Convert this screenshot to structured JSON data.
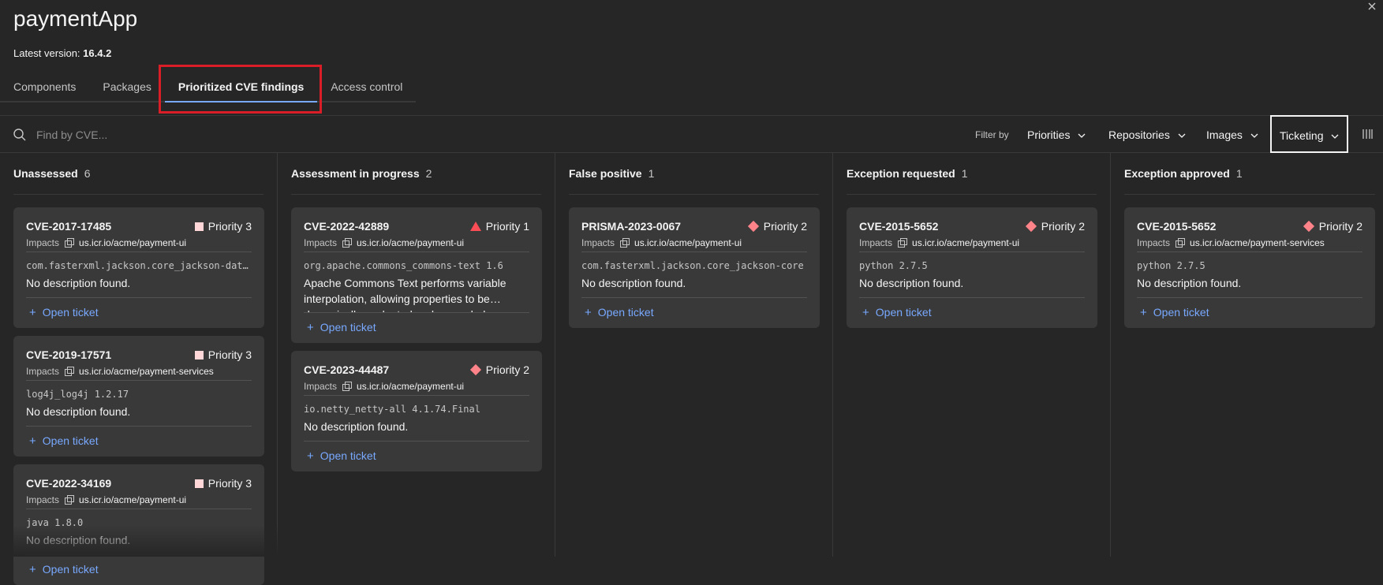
{
  "app": {
    "title": "paymentApp",
    "version_label": "Latest version:",
    "version_value": "16.4.2"
  },
  "tabs": [
    {
      "label": "Components",
      "active": false
    },
    {
      "label": "Packages",
      "active": false
    },
    {
      "label": "Prioritized CVE findings",
      "active": true
    },
    {
      "label": "Access control",
      "active": false
    }
  ],
  "toolbar": {
    "search_placeholder": "Find by CVE...",
    "filter_label": "Filter by",
    "filters": [
      "Priorities",
      "Repositories",
      "Images",
      "Ticketing"
    ]
  },
  "columns": [
    {
      "title": "Unassessed",
      "count": "6",
      "cards": [
        {
          "cve": "CVE-2017-17485",
          "priority": "Priority 3",
          "priority_icon": "square",
          "impacts_label": "Impacts",
          "repo": "us.icr.io/acme/payment-ui",
          "package": "com.fasterxml.jackson.core_jackson-databind",
          "description": "No description found.",
          "action": "Open ticket"
        },
        {
          "cve": "CVE-2019-17571",
          "priority": "Priority 3",
          "priority_icon": "square",
          "impacts_label": "Impacts",
          "repo": "us.icr.io/acme/payment-services",
          "package": "log4j_log4j 1.2.17",
          "description": "No description found.",
          "action": "Open ticket"
        },
        {
          "cve": "CVE-2022-34169",
          "priority": "Priority 3",
          "priority_icon": "square",
          "impacts_label": "Impacts",
          "repo": "us.icr.io/acme/payment-ui",
          "package": "java 1.8.0",
          "description": "No description found.",
          "action": "Open ticket"
        }
      ]
    },
    {
      "title": "Assessment in progress",
      "count": "2",
      "cards": [
        {
          "cve": "CVE-2022-42889",
          "priority": "Priority 1",
          "priority_icon": "triangle",
          "impacts_label": "Impacts",
          "repo": "us.icr.io/acme/payment-ui",
          "package": "org.apache.commons_commons-text 1.6",
          "description": "Apache Commons Text performs variable interpolation, allowing properties to be dynamically evaluated and expanded.",
          "action": "Open ticket"
        },
        {
          "cve": "CVE-2023-44487",
          "priority": "Priority 2",
          "priority_icon": "diamond",
          "impacts_label": "Impacts",
          "repo": "us.icr.io/acme/payment-ui",
          "package": "io.netty_netty-all 4.1.74.Final",
          "description": "No description found.",
          "action": "Open ticket"
        }
      ]
    },
    {
      "title": "False positive",
      "count": "1",
      "cards": [
        {
          "cve": "PRISMA-2023-0067",
          "priority": "Priority 2",
          "priority_icon": "diamond",
          "impacts_label": "Impacts",
          "repo": "us.icr.io/acme/payment-ui",
          "package": "com.fasterxml.jackson.core_jackson-core",
          "description": "No description found.",
          "action": "Open ticket"
        }
      ]
    },
    {
      "title": "Exception requested",
      "count": "1",
      "cards": [
        {
          "cve": "CVE-2015-5652",
          "priority": "Priority 2",
          "priority_icon": "diamond",
          "impacts_label": "Impacts",
          "repo": "us.icr.io/acme/payment-ui",
          "package": "python 2.7.5",
          "description": "No description found.",
          "action": "Open ticket"
        }
      ]
    },
    {
      "title": "Exception approved",
      "count": "1",
      "cards": [
        {
          "cve": "CVE-2015-5652",
          "priority": "Priority 2",
          "priority_icon": "diamond",
          "impacts_label": "Impacts",
          "repo": "us.icr.io/acme/payment-services",
          "package": "python 2.7.5",
          "description": "No description found.",
          "action": "Open ticket"
        }
      ]
    }
  ],
  "colors": {
    "background": "#262626",
    "card": "#393939",
    "link": "#78a9ff",
    "tab_underline": "#78a9ff",
    "highlight_box": "#da1e28",
    "priority1": "#fa4d56",
    "priority2": "#ff8389",
    "priority3": "#ffd7d9"
  }
}
